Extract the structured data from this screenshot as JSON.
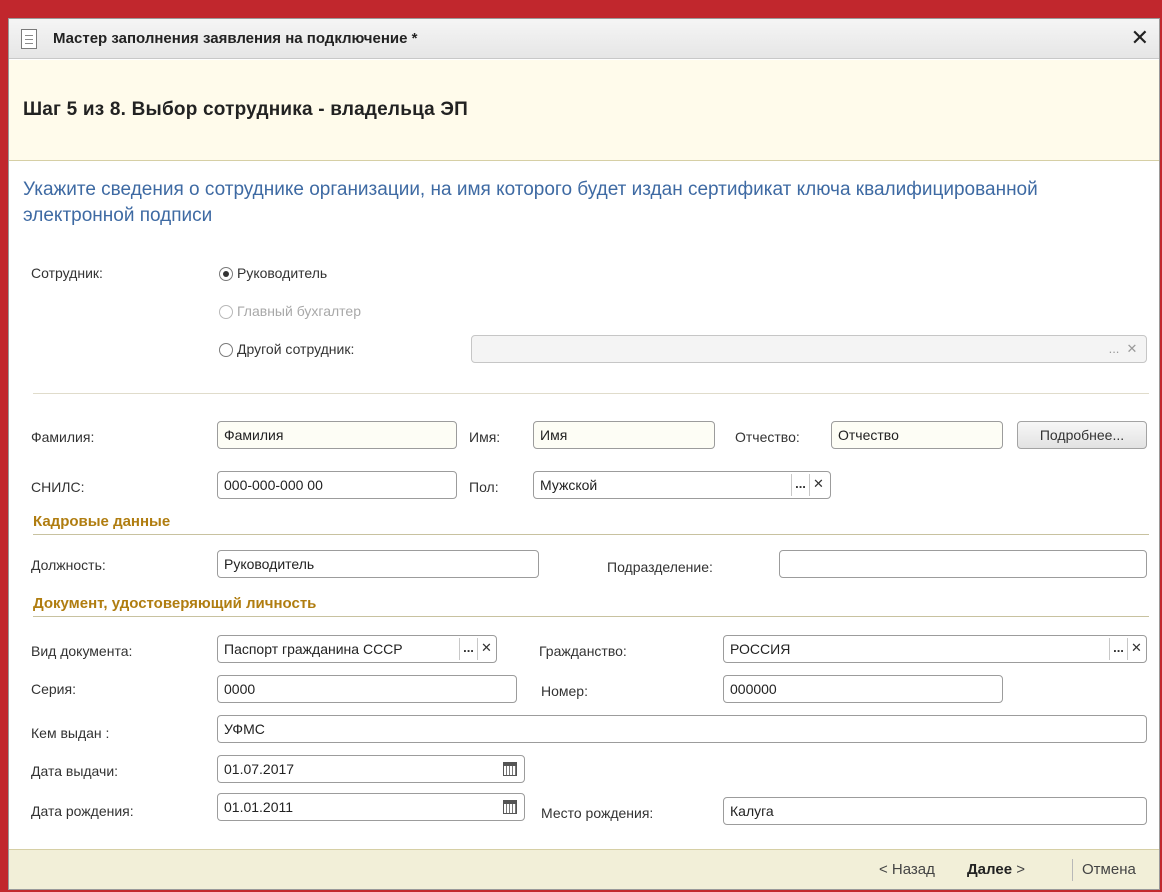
{
  "window": {
    "title": "Мастер заполнения заявления на подключение *",
    "close_glyph": "✕"
  },
  "step": {
    "title": "Шаг 5 из 8. Выбор сотрудника - владельца ЭП",
    "instruction": "Укажите сведения о сотруднике организации, на имя которого будет издан сертификат ключа квалифицированной электронной подписи"
  },
  "employee": {
    "label": "Сотрудник:",
    "options": [
      {
        "label": "Руководитель",
        "selected": true,
        "enabled": true
      },
      {
        "label": "Главный бухгалтер",
        "selected": false,
        "enabled": false
      },
      {
        "label": "Другой сотрудник:",
        "selected": false,
        "enabled": true
      }
    ],
    "other_value": ""
  },
  "person": {
    "surname_label": "Фамилия:",
    "surname_value": "Фамилия",
    "name_label": "Имя:",
    "name_value": "Имя",
    "patronymic_label": "Отчество:",
    "patronymic_value": "Отчество",
    "details_button": "Подробнее...",
    "snils_label": "СНИЛС:",
    "snils_value": "000-000-000 00",
    "gender_label": "Пол:",
    "gender_value": "Мужской"
  },
  "hr_data": {
    "heading": "Кадровые данные",
    "position_label": "Должность:",
    "position_value": "Руководитель",
    "department_label": "Подразделение:",
    "department_value": ""
  },
  "identity_doc": {
    "heading": "Документ, удостоверяющий личность",
    "doc_type_label": "Вид документа:",
    "doc_type_value": "Паспорт гражданина СССР",
    "citizenship_label": "Гражданство:",
    "citizenship_value": "РОССИЯ",
    "series_label": "Серия:",
    "series_value": "0000",
    "number_label": "Номер:",
    "number_value": "000000",
    "issued_by_label": "Кем выдан :",
    "issued_by_value": "УФМС",
    "issue_date_label": "Дата выдачи:",
    "issue_date_value": "01.07.2017",
    "birth_date_label": "Дата рождения:",
    "birth_date_value": "01.01.2011",
    "birth_place_label": "Место рождения:",
    "birth_place_value": "Калуга"
  },
  "field_buttons": {
    "select": "...",
    "clear": "✕"
  },
  "footer": {
    "back": "< Назад",
    "next": "Далее",
    "next_arrow": ">",
    "cancel": "Отмена"
  },
  "colors": {
    "accent_blue": "#3e6aa3",
    "section_orange": "#b07d10",
    "step_bg": "#fffbeb",
    "frame_red": "#c1272d"
  }
}
